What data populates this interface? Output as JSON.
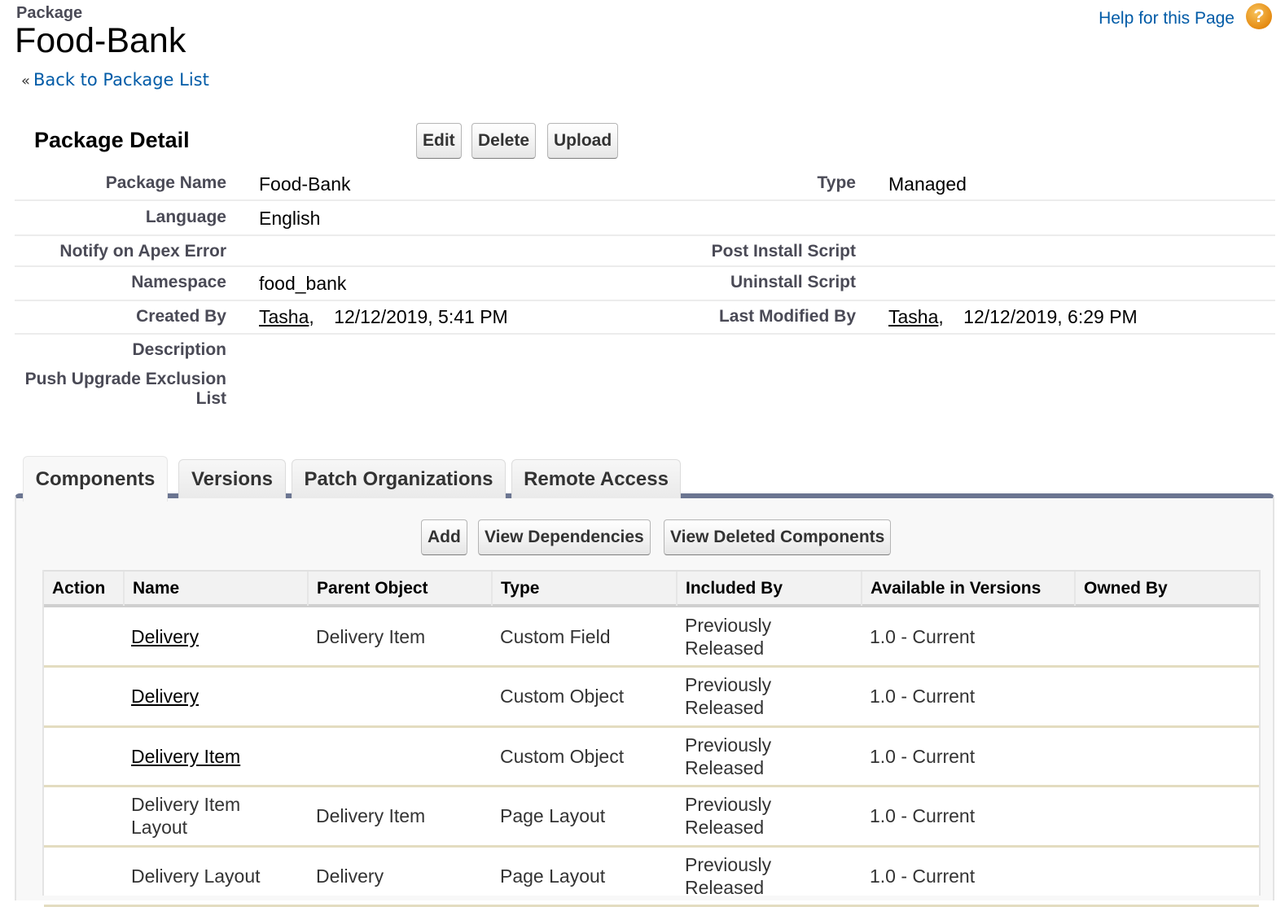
{
  "header": {
    "page_type": "Package",
    "title": "Food-Bank",
    "back_link": "Back to Package List",
    "back_prefix": "«",
    "help_link": "Help for this Page",
    "help_icon": "?"
  },
  "detail": {
    "section_title": "Package Detail",
    "buttons": {
      "edit": "Edit",
      "delete": "Delete",
      "upload": "Upload"
    },
    "fields": {
      "package_name": {
        "label": "Package Name",
        "value": "Food-Bank"
      },
      "type": {
        "label": "Type",
        "value": "Managed"
      },
      "language": {
        "label": "Language",
        "value": "English"
      },
      "notify_on_apex_error": {
        "label": "Notify on Apex Error",
        "value": ""
      },
      "post_install_script": {
        "label": "Post Install Script",
        "value": ""
      },
      "namespace": {
        "label": "Namespace",
        "value": "food_bank"
      },
      "uninstall_script": {
        "label": "Uninstall Script",
        "value": ""
      },
      "created_by": {
        "label": "Created By",
        "user": "Tasha",
        "date": "12/12/2019, 5:41 PM"
      },
      "last_modified_by": {
        "label": "Last Modified By",
        "user": "Tasha",
        "date": "12/12/2019, 6:29 PM"
      },
      "description": {
        "label": "Description",
        "value": ""
      },
      "push_upgrade_exclusion_list": {
        "label_line1": "Push Upgrade Exclusion",
        "label_line2": "List",
        "value": ""
      }
    }
  },
  "tabs": [
    {
      "label": "Components",
      "active": true
    },
    {
      "label": "Versions",
      "active": false
    },
    {
      "label": "Patch Organizations",
      "active": false
    },
    {
      "label": "Remote Access",
      "active": false
    }
  ],
  "components": {
    "buttons": {
      "add": "Add",
      "view_dependencies": "View Dependencies",
      "view_deleted": "View Deleted Components"
    },
    "columns": [
      "Action",
      "Name",
      "Parent Object",
      "Type",
      "Included By",
      "Available in Versions",
      "Owned By"
    ],
    "rows": [
      {
        "action": "",
        "name": "Delivery",
        "name_link": true,
        "parent": "Delivery Item",
        "type": "Custom Field",
        "included_by": "Previously Released",
        "versions": "1.0 - Current",
        "owned_by": ""
      },
      {
        "action": "",
        "name": "Delivery",
        "name_link": true,
        "parent": "",
        "type": "Custom Object",
        "included_by": "Previously Released",
        "versions": "1.0 - Current",
        "owned_by": ""
      },
      {
        "action": "",
        "name": "Delivery Item",
        "name_link": true,
        "parent": "",
        "type": "Custom Object",
        "included_by": "Previously Released",
        "versions": "1.0 - Current",
        "owned_by": ""
      },
      {
        "action": "",
        "name": "Delivery Item Layout",
        "name_link": false,
        "parent": "Delivery Item",
        "type": "Page Layout",
        "included_by": "Previously Released",
        "versions": "1.0 - Current",
        "owned_by": ""
      },
      {
        "action": "",
        "name": "Delivery Layout",
        "name_link": false,
        "parent": "Delivery",
        "type": "Page Layout",
        "included_by": "Previously Released",
        "versions": "1.0 - Current",
        "owned_by": ""
      }
    ]
  }
}
